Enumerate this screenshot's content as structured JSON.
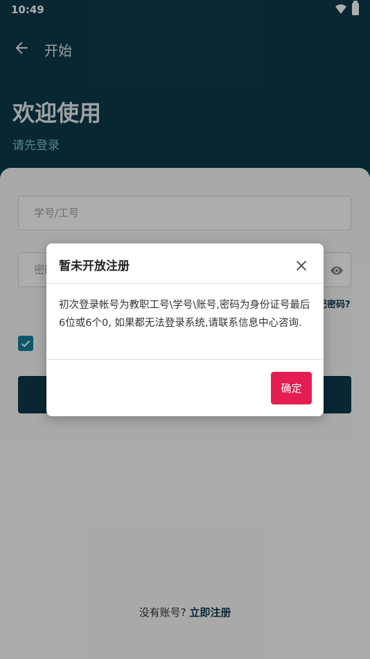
{
  "status_bar": {
    "time": "10:49"
  },
  "app_bar": {
    "title": "开始"
  },
  "header": {
    "welcome": "欢迎使用",
    "subtitle": "请先登录"
  },
  "form": {
    "account_placeholder": "学号/工号",
    "password_placeholder": "密码",
    "forgot_password": "忘记密码?",
    "remember_checked": true
  },
  "footer": {
    "prompt": "没有账号?",
    "register_link": "立即注册"
  },
  "dialog": {
    "title": "暂未开放注册",
    "body": "初次登录帐号为教职工号\\学号\\账号,密码为身份证号最后6位或6个0, 如果都无法登录系统,请联系信息中心咨询.",
    "confirm_label": "确定"
  },
  "colors": {
    "header_bg": "#0d3a4c",
    "accent_text": "#7ac4d2",
    "checkbox": "#147fa0",
    "confirm_button": "#e41e52"
  },
  "icons": {
    "back": "arrow-left-icon",
    "close": "close-icon",
    "eye": "eye-icon",
    "check": "check-icon",
    "wifi": "wifi-icon",
    "battery": "battery-icon"
  }
}
